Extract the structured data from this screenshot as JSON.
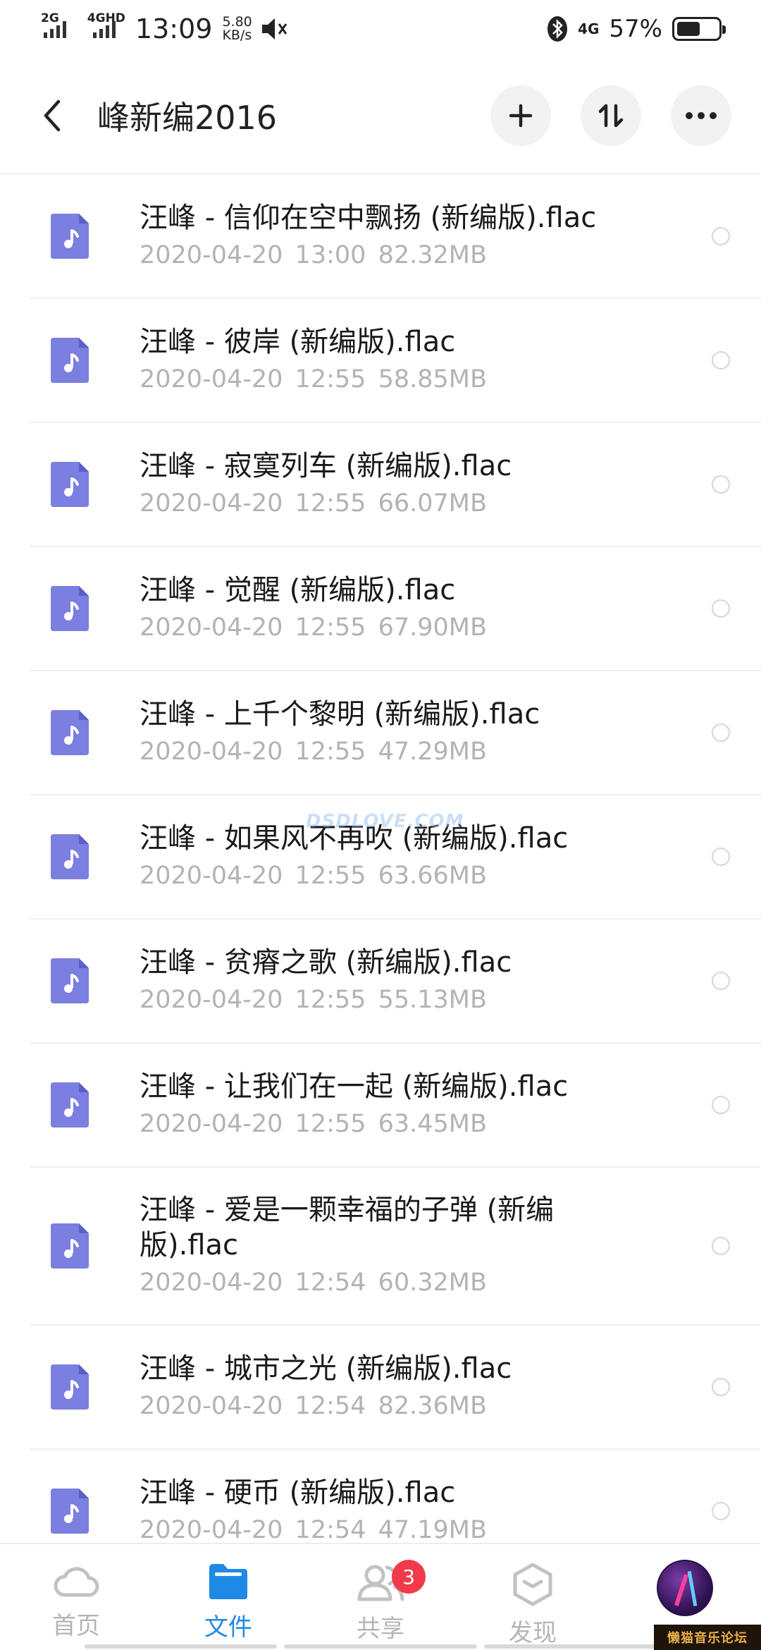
{
  "status_bar": {
    "signal1_label": "2G",
    "signal2_label": "4GHD",
    "time": "13:09",
    "net_speed_value": "5.80",
    "net_speed_unit": "KB/s",
    "network_type": "4G",
    "battery_percent": "57%",
    "battery_level": 0.57
  },
  "header": {
    "title": "峰新编2016"
  },
  "files": [
    {
      "name": "汪峰 - 信仰在空中飘扬 (新编版).flac",
      "date": "2020-04-20",
      "time": "13:00",
      "size": "82.32MB"
    },
    {
      "name": "汪峰 - 彼岸 (新编版).flac",
      "date": "2020-04-20",
      "time": "12:55",
      "size": "58.85MB"
    },
    {
      "name": "汪峰 - 寂寞列车 (新编版).flac",
      "date": "2020-04-20",
      "time": "12:55",
      "size": "66.07MB"
    },
    {
      "name": "汪峰 - 觉醒 (新编版).flac",
      "date": "2020-04-20",
      "time": "12:55",
      "size": "67.90MB"
    },
    {
      "name": "汪峰 - 上千个黎明 (新编版).flac",
      "date": "2020-04-20",
      "time": "12:55",
      "size": "47.29MB"
    },
    {
      "name": "汪峰 - 如果风不再吹 (新编版).flac",
      "date": "2020-04-20",
      "time": "12:55",
      "size": "63.66MB"
    },
    {
      "name": "汪峰 - 贫瘠之歌 (新编版).flac",
      "date": "2020-04-20",
      "time": "12:55",
      "size": "55.13MB"
    },
    {
      "name": "汪峰 - 让我们在一起 (新编版).flac",
      "date": "2020-04-20",
      "time": "12:55",
      "size": "63.45MB"
    },
    {
      "name": "汪峰 - 爱是一颗幸福的子弹 (新编版).flac",
      "date": "2020-04-20",
      "time": "12:54",
      "size": "60.32MB"
    },
    {
      "name": "汪峰 - 城市之光 (新编版).flac",
      "date": "2020-04-20",
      "time": "12:54",
      "size": "82.36MB"
    },
    {
      "name": "汪峰 - 硬币 (新编版).flac",
      "date": "2020-04-20",
      "time": "12:54",
      "size": "47.19MB"
    }
  ],
  "watermark": "DSDLOVE.COM",
  "bottom_nav": {
    "items": [
      {
        "label": "首页",
        "icon": "cloud-icon"
      },
      {
        "label": "文件",
        "icon": "folder-icon"
      },
      {
        "label": "共享",
        "icon": "people-icon",
        "badge": "3"
      },
      {
        "label": "发现",
        "icon": "discover-icon"
      },
      {
        "label": "",
        "icon": "avatar"
      }
    ],
    "active_index": 1
  },
  "corner_stamp": "懒猫音乐论坛",
  "colors": {
    "accent": "#1e8ae6",
    "file_icon": "#7b7fe0",
    "badge": "#f23a4b",
    "meta_text": "#b3b3b3"
  }
}
